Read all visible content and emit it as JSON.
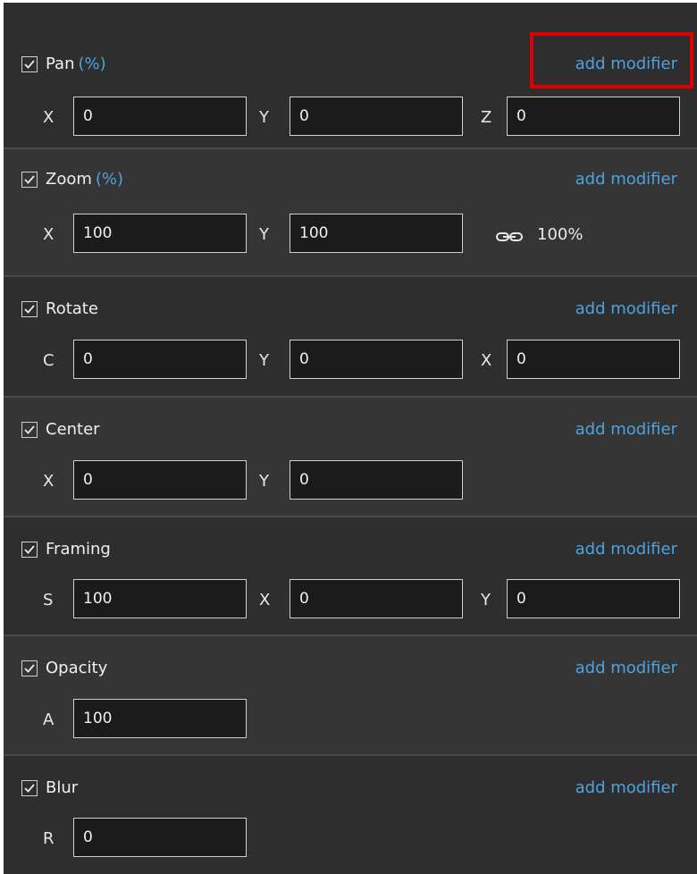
{
  "colors": {
    "panel_bg": "#2e2e2e",
    "panel_alt_bg": "#353535",
    "accent": "#4da3e0",
    "input_bg": "#1b1b1b",
    "highlight": "#e00000"
  },
  "add_modifier_label": "add modifier",
  "sections": [
    {
      "title": "Pan",
      "unit": "(%)",
      "checked": true,
      "fields": [
        {
          "label": "X",
          "value": "0"
        },
        {
          "label": "Y",
          "value": "0"
        },
        {
          "label": "Z",
          "value": "0"
        }
      ]
    },
    {
      "title": "Zoom",
      "unit": "(%)",
      "checked": true,
      "fields": [
        {
          "label": "X",
          "value": "100"
        },
        {
          "label": "Y",
          "value": "100"
        }
      ],
      "link_icon": "chain-link-icon",
      "link_value": "100%"
    },
    {
      "title": "Rotate",
      "checked": true,
      "fields": [
        {
          "label": "C",
          "value": "0"
        },
        {
          "label": "Y",
          "value": "0"
        },
        {
          "label": "X",
          "value": "0"
        }
      ]
    },
    {
      "title": "Center",
      "checked": true,
      "fields": [
        {
          "label": "X",
          "value": "0"
        },
        {
          "label": "Y",
          "value": "0"
        }
      ]
    },
    {
      "title": "Framing",
      "checked": true,
      "fields": [
        {
          "label": "S",
          "value": "100"
        },
        {
          "label": "X",
          "value": "0"
        },
        {
          "label": "Y",
          "value": "0"
        }
      ]
    },
    {
      "title": "Opacity",
      "checked": true,
      "fields": [
        {
          "label": "A",
          "value": "100"
        }
      ]
    },
    {
      "title": "Blur",
      "checked": true,
      "fields": [
        {
          "label": "R",
          "value": "0"
        }
      ]
    }
  ]
}
